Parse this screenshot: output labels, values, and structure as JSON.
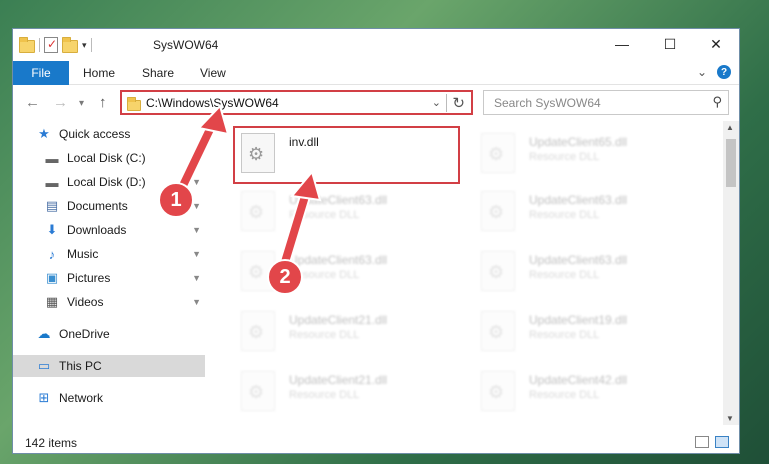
{
  "window": {
    "title": "SysWOW64",
    "controls": {
      "minimize": "—",
      "maximize": "☐",
      "close": "✕"
    }
  },
  "ribbon": {
    "tabs": [
      "File",
      "Home",
      "Share",
      "View"
    ],
    "expand_glyph": "⌄",
    "help_glyph": "?"
  },
  "navigation": {
    "back_glyph": "←",
    "forward_glyph": "→",
    "recent_glyph": "▾",
    "up_glyph": "↑",
    "address_path": "C:\\Windows\\SysWOW64",
    "address_chevron": "⌄",
    "refresh_glyph": "↻",
    "search_placeholder": "Search SysWOW64",
    "search_glyph": "⚲"
  },
  "sidebar": {
    "items": [
      {
        "label": "Quick access",
        "icon": "star-icon",
        "glyph": "★",
        "pinned": false
      },
      {
        "label": "Local Disk (C:)",
        "icon": "disk-icon",
        "glyph": "▬",
        "pinned": false
      },
      {
        "label": "Local Disk (D:)",
        "icon": "disk-icon",
        "glyph": "▬",
        "pinned": true
      },
      {
        "label": "Documents",
        "icon": "documents-icon",
        "glyph": "▤",
        "pinned": true
      },
      {
        "label": "Downloads",
        "icon": "download-icon",
        "glyph": "⬇",
        "pinned": true
      },
      {
        "label": "Music",
        "icon": "music-icon",
        "glyph": "♪",
        "pinned": true
      },
      {
        "label": "Pictures",
        "icon": "pictures-icon",
        "glyph": "▣",
        "pinned": true
      },
      {
        "label": "Videos",
        "icon": "videos-icon",
        "glyph": "▦",
        "pinned": true
      },
      {
        "label": "OneDrive",
        "icon": "cloud-icon",
        "glyph": "☁",
        "pinned": false
      },
      {
        "label": "This PC",
        "icon": "computer-icon",
        "glyph": "▭",
        "pinned": false
      },
      {
        "label": "Network",
        "icon": "network-icon",
        "glyph": "⊞",
        "pinned": false
      }
    ],
    "pin_glyph": "📌"
  },
  "files": {
    "highlighted": {
      "name": "inv.dll",
      "type": ""
    },
    "left_column": [
      {
        "name": "UpdateClient63.dll",
        "type": "Resource DLL"
      },
      {
        "name": "UpdateClient63.dll",
        "type": "Resource DLL"
      },
      {
        "name": "UpdateClient21.dll",
        "type": "Resource DLL"
      },
      {
        "name": "UpdateClient21.dll",
        "type": "Resource DLL"
      }
    ],
    "right_column": [
      {
        "name": "UpdateClient65.dll",
        "type": "Resource DLL"
      },
      {
        "name": "UpdateClient63.dll",
        "type": "Resource DLL"
      },
      {
        "name": "UpdateClient63.dll",
        "type": "Resource DLL"
      },
      {
        "name": "UpdateClient19.dll",
        "type": "Resource DLL"
      },
      {
        "name": "UpdateClient42.dll",
        "type": "Resource DLL"
      }
    ]
  },
  "status": {
    "item_count": "142 items"
  },
  "annotations": {
    "step1": "1",
    "step2": "2",
    "accent_color": "#e2464a"
  },
  "scroll": {
    "up_glyph": "▲",
    "down_glyph": "▼"
  }
}
